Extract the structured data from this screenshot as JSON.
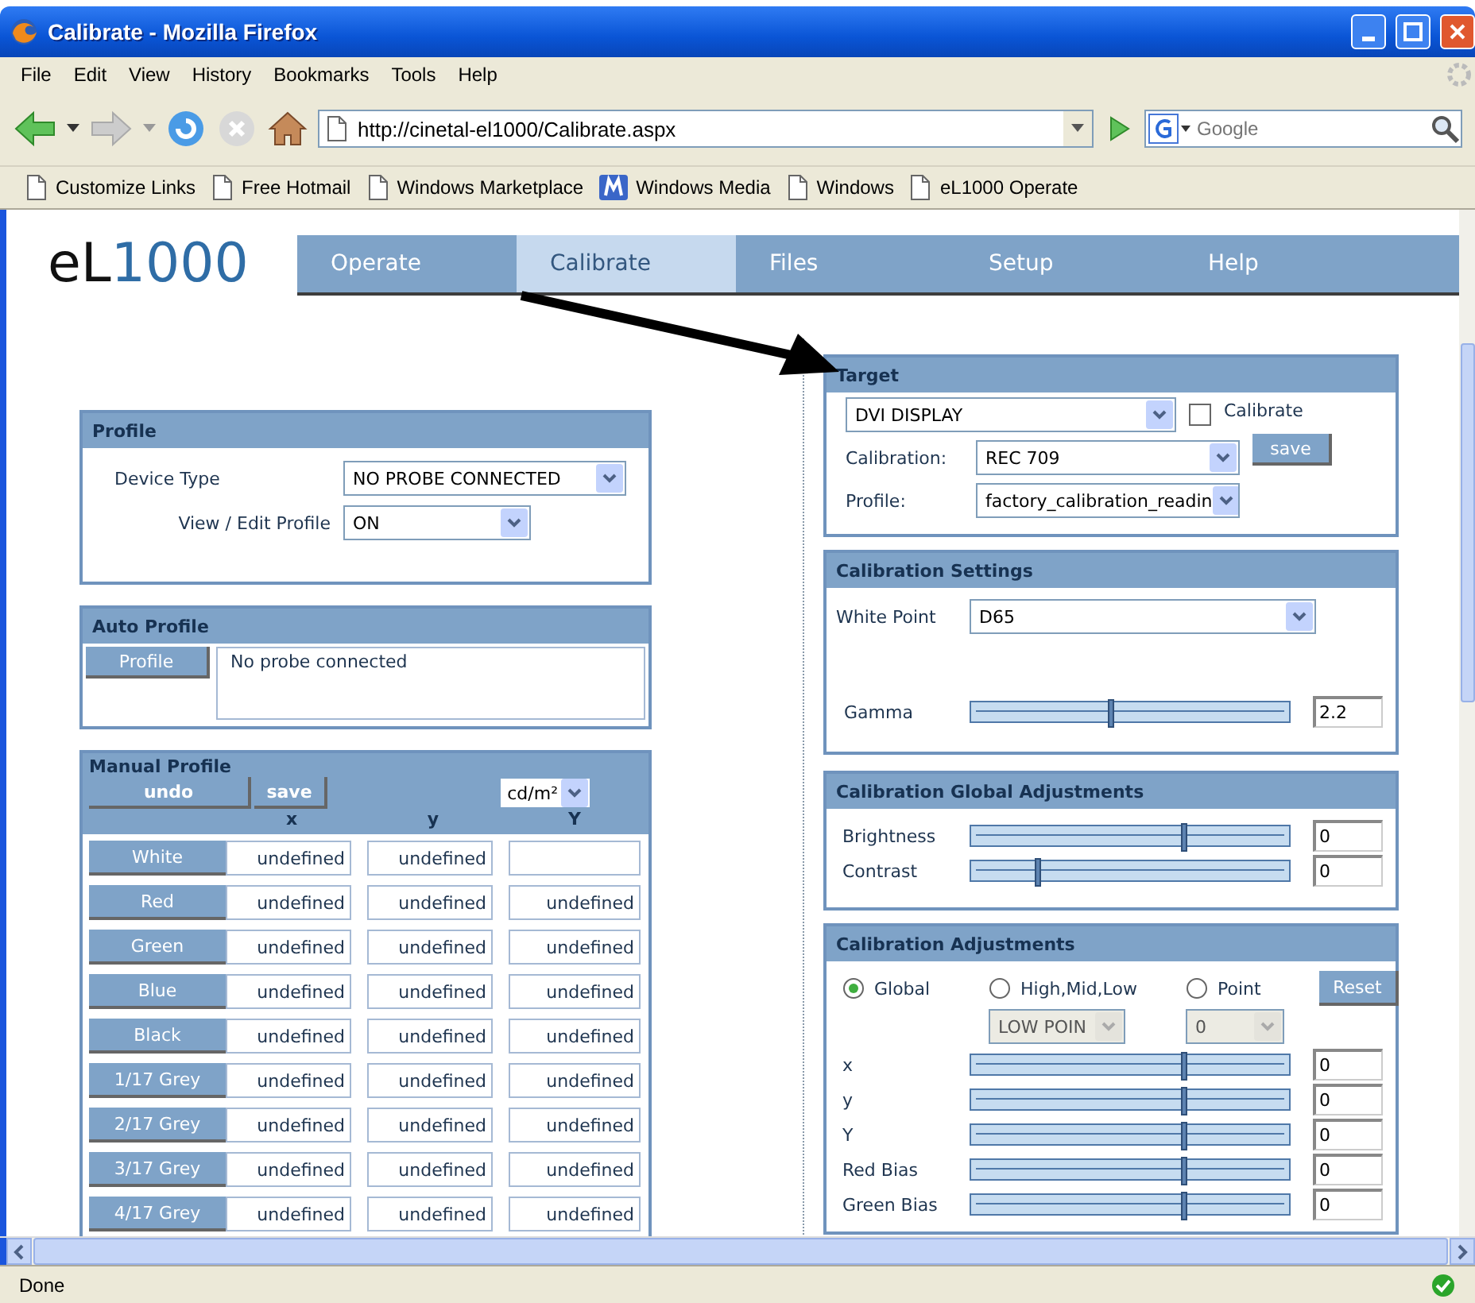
{
  "window": {
    "title": "Calibrate - Mozilla Firefox"
  },
  "menu": [
    "File",
    "Edit",
    "View",
    "History",
    "Bookmarks",
    "Tools",
    "Help"
  ],
  "address": {
    "value": "http://cinetal-el1000/Calibrate.aspx"
  },
  "search": {
    "placeholder": "Google"
  },
  "bookmarks": [
    {
      "label": "Customize Links",
      "kind": "page"
    },
    {
      "label": "Free Hotmail",
      "kind": "page"
    },
    {
      "label": "Windows Marketplace",
      "kind": "page"
    },
    {
      "label": "Windows Media",
      "kind": "media"
    },
    {
      "label": "Windows",
      "kind": "page"
    },
    {
      "label": "eL1000 Operate",
      "kind": "page"
    }
  ],
  "logo": {
    "prefix": "eL",
    "number": "1000"
  },
  "nav": [
    {
      "label": "Operate",
      "selected": false
    },
    {
      "label": "Calibrate",
      "selected": true
    },
    {
      "label": "Files",
      "selected": false
    },
    {
      "label": "Setup",
      "selected": false
    },
    {
      "label": "Help",
      "selected": false
    }
  ],
  "profile": {
    "title": "Profile",
    "device_type": {
      "label": "Device Type",
      "value": "NO PROBE CONNECTED"
    },
    "view_edit": {
      "label": "View / Edit Profile",
      "value": "ON"
    }
  },
  "auto_profile": {
    "title": "Auto Profile",
    "button": "Profile",
    "message": "No probe connected"
  },
  "manual_profile": {
    "title": "Manual Profile",
    "undo": "undo",
    "save": "save",
    "unit": "cd/m²",
    "columns": [
      "x",
      "y",
      "Y"
    ],
    "rows": [
      {
        "label": "White",
        "x": "undefined",
        "y": "undefined"
      },
      {
        "label": "Red",
        "x": "undefined",
        "y": "undefined",
        "Y": "undefined"
      },
      {
        "label": "Green",
        "x": "undefined",
        "y": "undefined",
        "Y": "undefined"
      },
      {
        "label": "Blue",
        "x": "undefined",
        "y": "undefined",
        "Y": "undefined"
      },
      {
        "label": "Black",
        "x": "undefined",
        "y": "undefined",
        "Y": "undefined"
      },
      {
        "label": "1/17 Grey",
        "x": "undefined",
        "y": "undefined",
        "Y": "undefined"
      },
      {
        "label": "2/17 Grey",
        "x": "undefined",
        "y": "undefined",
        "Y": "undefined"
      },
      {
        "label": "3/17 Grey",
        "x": "undefined",
        "y": "undefined",
        "Y": "undefined"
      },
      {
        "label": "4/17 Grey",
        "x": "undefined",
        "y": "undefined",
        "Y": "undefined"
      }
    ]
  },
  "target": {
    "title": "Target",
    "display": "DVI DISPLAY",
    "calibrate": {
      "label": "Calibrate",
      "checked": false
    },
    "calibration": {
      "label": "Calibration:",
      "value": "REC 709"
    },
    "save": "save",
    "profile": {
      "label": "Profile:",
      "value": "factory_calibration_readin"
    }
  },
  "calibration_settings": {
    "title": "Calibration Settings",
    "white_point": {
      "label": "White Point",
      "value": "D65"
    },
    "gamma": {
      "label": "Gamma",
      "level": 0.44,
      "value": "2.2"
    }
  },
  "global_adjustments": {
    "title": "Calibration Global Adjustments",
    "sliders": [
      {
        "label": "Brightness",
        "level": 0.67,
        "value": "0"
      },
      {
        "label": "Contrast",
        "level": 0.21,
        "value": "0"
      }
    ]
  },
  "adjustments": {
    "title": "Calibration Adjustments",
    "modes": [
      {
        "label": "Global",
        "selected": true
      },
      {
        "label": "High,Mid,Low",
        "selected": false
      },
      {
        "label": "Point",
        "selected": false
      }
    ],
    "mode_selects": [
      {
        "value": "LOW POIN",
        "disabled": true
      },
      {
        "value": "0",
        "disabled": true
      }
    ],
    "reset": "Reset",
    "sliders": [
      {
        "label": "x",
        "level": 0.67,
        "value": "0"
      },
      {
        "label": "y",
        "level": 0.67,
        "value": "0"
      },
      {
        "label": "Y",
        "level": 0.67,
        "value": "0"
      },
      {
        "label": "Red Bias",
        "level": 0.67,
        "value": "0"
      },
      {
        "label": "Green Bias",
        "level": 0.67,
        "value": "0"
      }
    ]
  },
  "status_bar": {
    "text": "Done"
  }
}
